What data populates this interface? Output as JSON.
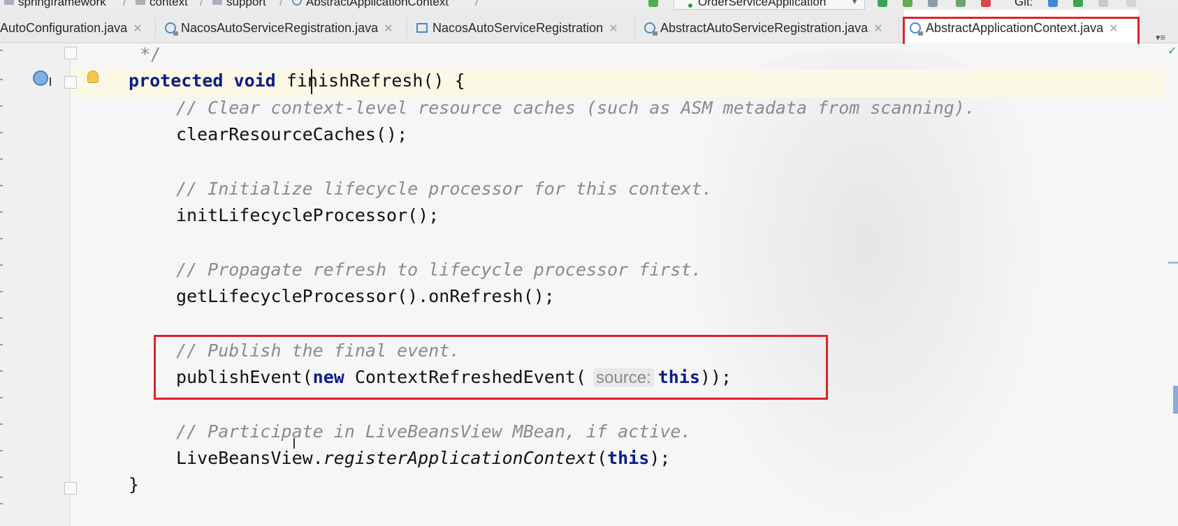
{
  "breadcrumb": {
    "items": [
      "springframework",
      "context",
      "support",
      "AbstractApplicationContext"
    ],
    "separator": "/"
  },
  "toolbar": {
    "run_config": "OrderServiceApplication",
    "git_label": "Git:"
  },
  "tabs": [
    {
      "label": "AutoConfiguration.java",
      "icon": "class-icon",
      "active": false
    },
    {
      "label": "NacosAutoServiceRegistration.java",
      "icon": "class-icon",
      "active": false
    },
    {
      "label": "NacosAutoServiceRegistration",
      "icon": "structure-icon",
      "active": false
    },
    {
      "label": "AbstractAutoServiceRegistration.java",
      "icon": "class-icon",
      "active": false
    },
    {
      "label": "AbstractApplicationContext.java",
      "icon": "class-icon",
      "active": true
    }
  ],
  "code": {
    "comment_end": "*/",
    "signature": {
      "modifier": "protected",
      "type": "void",
      "name": "finishRefresh",
      "rest": "() {"
    },
    "c1": "// Clear context-level resource caches (such as ASM metadata from scanning).",
    "s1": "clearResourceCaches();",
    "c2": "// Initialize lifecycle processor for this context.",
    "s2": "initLifecycleProcessor();",
    "c3": "// Propagate refresh to lifecycle processor first.",
    "s3": "getLifecycleProcessor().onRefresh();",
    "c4": "// Publish the final event.",
    "s4": {
      "call": "publishEvent(",
      "new_kw": "new",
      "ctor": " ContextRefreshedEvent(",
      "hint": "source:",
      "this_kw": "this",
      "end": "));"
    },
    "c5": "// Participate in LiveBeansView MBean, if active.",
    "s5": {
      "cls": "LiveBeansView.",
      "method": "registerApplicationContext",
      "open": "(",
      "this_kw": "this",
      "end": ");"
    },
    "close": "}"
  },
  "colors": {
    "keyword": "#0a1c88",
    "comment": "#8a8a8a",
    "highlight_box": "#e0202a",
    "current_line": "#fbf8e6"
  }
}
